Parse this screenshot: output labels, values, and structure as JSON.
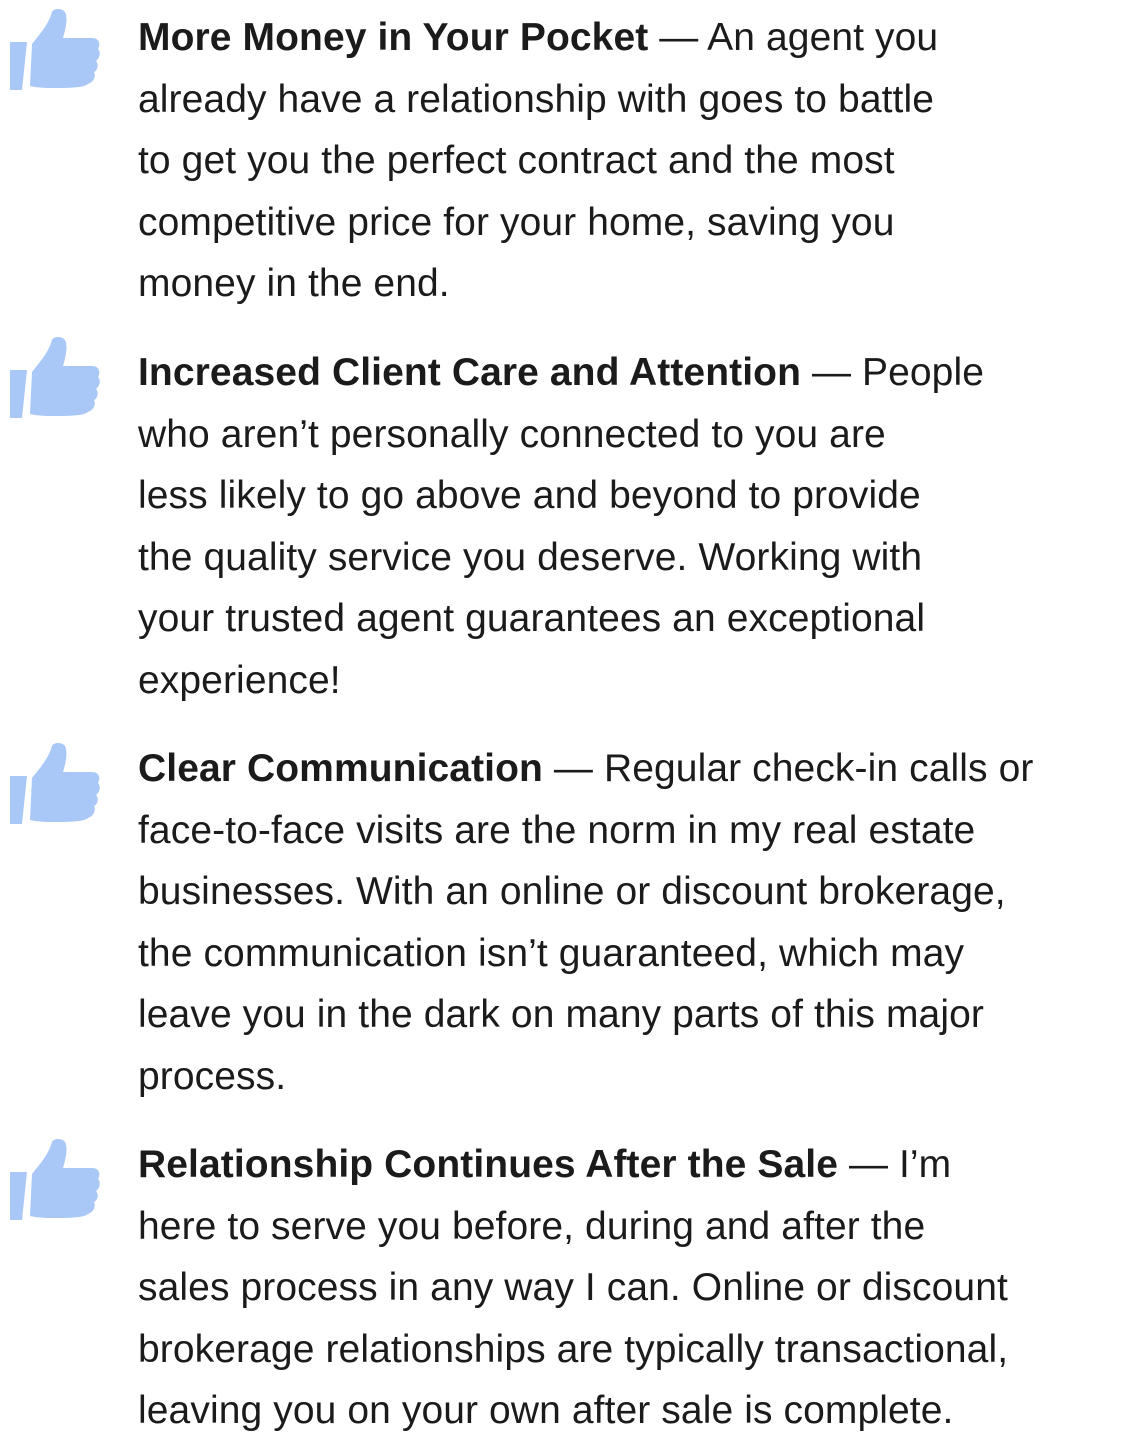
{
  "icon_color": "#a9c8f7",
  "benefits": [
    {
      "icon": "thumbs-up-icon",
      "heading": "More Money in Your Pocket",
      "first_line_rest": " — An agent you",
      "lines": [
        "already have a relationship with goes to battle",
        "to get you the perfect contract and the most",
        "competitive price for your home, saving you",
        "money in the end."
      ]
    },
    {
      "icon": "thumbs-up-icon",
      "heading": "Increased Client Care and Attention",
      "first_line_rest": " — People",
      "lines": [
        "who aren’t personally connected to you are",
        "less likely to go above and beyond to provide",
        "the quality service you deserve. Working with",
        "your trusted agent guarantees an exceptional",
        "experience!"
      ]
    },
    {
      "icon": "thumbs-up-icon",
      "heading": "Clear Communication",
      "first_line_rest": " — Regular check-in calls or",
      "lines": [
        "face-to-face visits are the norm in my real estate",
        "businesses. With an online or discount brokerage,",
        "the communication isn’t guaranteed, which may",
        "leave you in the dark on many parts of this major",
        "process."
      ]
    },
    {
      "icon": "thumbs-up-icon",
      "heading": "Relationship Continues After the Sale",
      "first_line_rest": " — I’m",
      "lines": [
        "here to serve you before, during and after the",
        "sales process in any way I can. Online or discount",
        "brokerage relationships are typically transactional,",
        "leaving you on your own after sale is complete."
      ]
    }
  ]
}
